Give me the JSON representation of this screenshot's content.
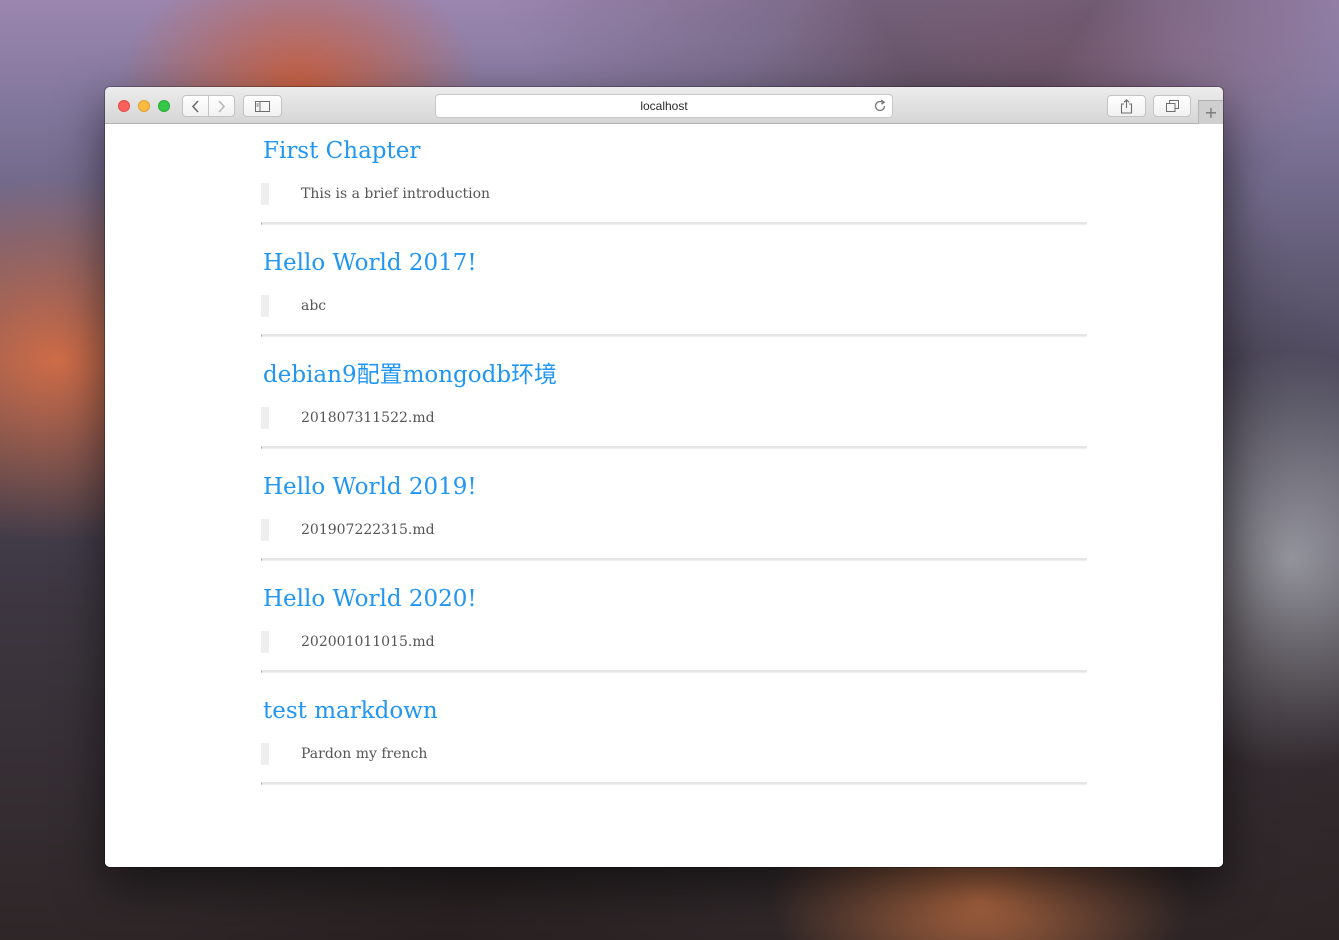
{
  "browser": {
    "address": "localhost",
    "new_tab_label": "+"
  },
  "icons": {
    "back": "chevron-left-icon",
    "forward": "chevron-right-icon",
    "sidebar": "sidebar-icon",
    "reload": "reload-icon",
    "share": "share-icon",
    "tabs": "tabs-overview-icon"
  },
  "colors": {
    "link": "#2196f3",
    "quote_border": "#eeeeee",
    "divider": "#e5e5e5",
    "text": "#555555"
  },
  "posts": [
    {
      "title": "First Chapter",
      "summary": "This is a brief introduction"
    },
    {
      "title": "Hello World 2017!",
      "summary": "abc"
    },
    {
      "title": "debian9配置mongodb环境",
      "summary": "201807311522.md"
    },
    {
      "title": "Hello World 2019!",
      "summary": "201907222315.md"
    },
    {
      "title": "Hello World 2020!",
      "summary": "202001011015.md"
    },
    {
      "title": "test markdown",
      "summary": "Pardon my french"
    }
  ]
}
